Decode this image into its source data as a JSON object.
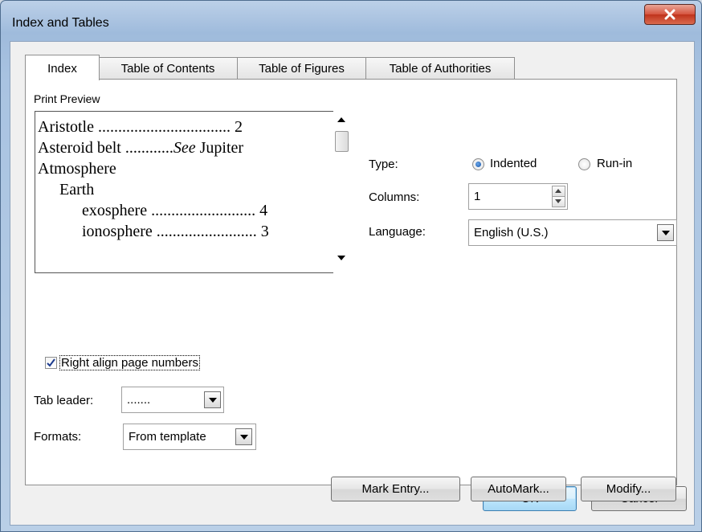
{
  "window": {
    "title": "Index and Tables"
  },
  "tabs": [
    {
      "label": "Index"
    },
    {
      "label": "Table of Contents"
    },
    {
      "label": "Table of Figures"
    },
    {
      "label": "Table of Authorities"
    }
  ],
  "preview": {
    "label": "Print Preview",
    "lines": [
      "Aristotle ................................. 2",
      "Asteroid belt ............See Jupiter",
      "Atmosphere",
      "Earth",
      "exosphere .......................... 4",
      "ionosphere ......................... 3"
    ]
  },
  "type": {
    "label": "Type:",
    "options": [
      "Indented",
      "Run-in"
    ],
    "selected": "Indented"
  },
  "columns": {
    "label": "Columns:",
    "value": "1"
  },
  "language": {
    "label": "Language:",
    "value": "English (U.S.)"
  },
  "right_align": {
    "label": "Right align page numbers",
    "checked": true
  },
  "tab_leader": {
    "label": "Tab leader:",
    "value": "......."
  },
  "formats": {
    "label": "Formats:",
    "value": "From template"
  },
  "buttons": {
    "mark_entry": "Mark Entry...",
    "automark": "AutoMark...",
    "modify": "Modify...",
    "ok": "OK",
    "cancel": "Cancel"
  }
}
